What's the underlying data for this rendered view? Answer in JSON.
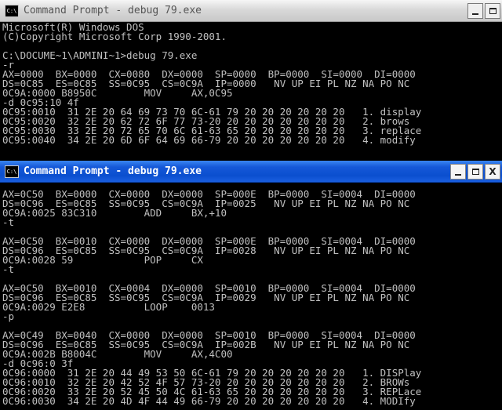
{
  "windows": {
    "back": {
      "title": "Command Prompt - debug 79.exe",
      "icon_label": "C:\\",
      "icon": "console-window-icon",
      "lines": [
        "Microsoft(R) Windows DOS",
        "(C)Copyright Microsoft Corp 1990-2001.",
        "",
        "C:\\DOCUME~1\\ADMINI~1>debug 79.exe",
        "-r",
        "AX=0000  BX=0000  CX=0080  DX=0000  SP=0000  BP=0000  SI=0000  DI=0000",
        "DS=0C85  ES=0C85  SS=0C95  CS=0C9A  IP=0000   NV UP EI PL NZ NA PO NC",
        "0C9A:0000 B8950C        MOV     AX,0C95",
        "-d 0c95:10 4f",
        "0C95:0010  31 2E 20 64 69 73 70 6C-61 79 20 20 20 20 20 20   1. display",
        "0C95:0020  32 2E 20 62 72 6F 77 73-20 20 20 20 20 20 20 20   2. brows",
        "0C95:0030  33 2E 20 72 65 70 6C 61-63 65 20 20 20 20 20 20   3. replace",
        "0C95:0040  34 2E 20 6D 6F 64 69 66-79 20 20 20 20 20 20 20   4. modify"
      ]
    },
    "front": {
      "title": "Command Prompt - debug 79.exe",
      "icon_label": "C:\\",
      "icon": "console-window-icon",
      "lines": [
        "AX=0C50  BX=0000  CX=0000  DX=0000  SP=000E  BP=0000  SI=0004  DI=0000",
        "DS=0C96  ES=0C85  SS=0C95  CS=0C9A  IP=0025   NV UP EI PL NZ NA PO NC",
        "0C9A:0025 83C310        ADD     BX,+10",
        "-t",
        "",
        "AX=0C50  BX=0010  CX=0000  DX=0000  SP=000E  BP=0000  SI=0004  DI=0000",
        "DS=0C96  ES=0C85  SS=0C95  CS=0C9A  IP=0028   NV UP EI PL NZ NA PO NC",
        "0C9A:0028 59            POP     CX",
        "-t",
        "",
        "AX=0C50  BX=0010  CX=0004  DX=0000  SP=0010  BP=0000  SI=0004  DI=0000",
        "DS=0C96  ES=0C85  SS=0C95  CS=0C9A  IP=0029   NV UP EI PL NZ NA PO NC",
        "0C9A:0029 E2E8          LOOP    0013",
        "-p",
        "",
        "AX=0C49  BX=0040  CX=0000  DX=0000  SP=0010  BP=0000  SI=0004  DI=0000",
        "DS=0C96  ES=0C85  SS=0C95  CS=0C9A  IP=002B   NV UP EI PL NZ NA PO NC",
        "0C9A:002B B8004C        MOV     AX,4C00",
        "-d 0c96:0 3f",
        "0C96:0000  31 2E 20 44 49 53 50 6C-61 79 20 20 20 20 20 20   1. DISPlay",
        "0C96:0010  32 2E 20 42 52 4F 57 73-20 20 20 20 20 20 20 20   2. BROWs",
        "0C96:0020  33 2E 20 52 45 50 4C 61-63 65 20 20 20 20 20 20   3. REPLace",
        "0C96:0030  34 2E 20 4D 4F 44 49 66-79 20 20 20 20 20 20 20   4. MODIfy"
      ]
    }
  },
  "controls": {
    "minimize": "minimize-icon",
    "maximize": "maximize-icon",
    "close_label": "X"
  }
}
